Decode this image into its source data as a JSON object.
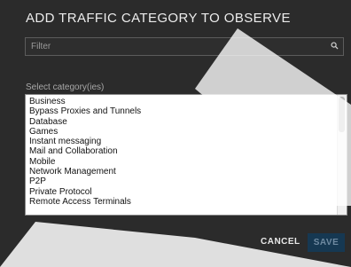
{
  "dialog": {
    "title": "ADD TRAFFIC CATEGORY TO OBSERVE"
  },
  "filter": {
    "placeholder": "Filter",
    "value": "",
    "icon": "search-icon"
  },
  "category_select": {
    "label": "Select category(ies)",
    "items": [
      "Business",
      "Bypass Proxies and Tunnels",
      "Database",
      "Games",
      "Instant messaging",
      "Mail and Collaboration",
      "Mobile",
      "Network Management",
      "P2P",
      "Private Protocol",
      "Remote Access Terminals"
    ]
  },
  "actions": {
    "cancel_label": "CANCEL",
    "save_label": "SAVE"
  },
  "colors": {
    "dialog_background": "#2b2b2b",
    "save_button_background": "#163852",
    "save_button_text": "#6f8aa1"
  }
}
